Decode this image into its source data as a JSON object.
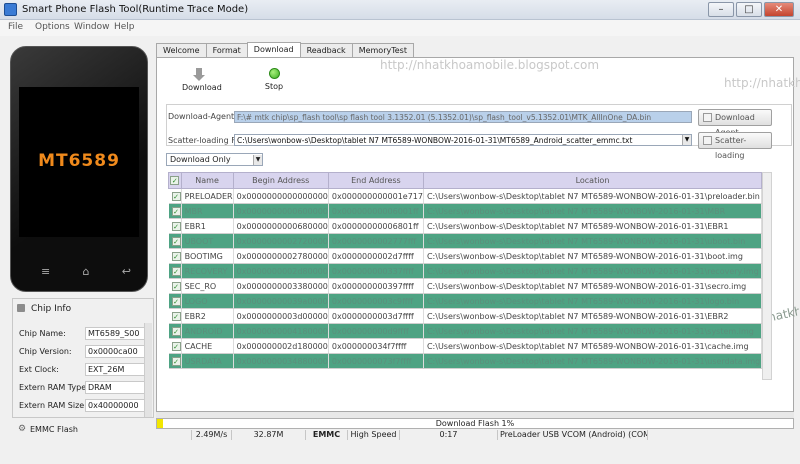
{
  "window": {
    "title": "Smart Phone Flash Tool(Runtime Trace Mode)",
    "minimize": "–",
    "maximize": "□",
    "close": "✕"
  },
  "menu": [
    "File",
    "Options",
    "Window",
    "Help"
  ],
  "watermark": "http://nhatkhoamobile.blogspot.com",
  "phone": {
    "chip_label": "MT6589",
    "keys": [
      "≡",
      "⌂",
      "↩"
    ]
  },
  "chip_info": {
    "title": "Chip Info",
    "rows": [
      {
        "label": "Chip Name:",
        "value": "MT6589_S00"
      },
      {
        "label": "Chip Version:",
        "value": "0x0000ca00"
      },
      {
        "label": "Ext Clock:",
        "value": "EXT_26M"
      },
      {
        "label": "Extern RAM Type:",
        "value": "DRAM"
      },
      {
        "label": "Extern RAM Size:",
        "value": "0x40000000"
      }
    ],
    "emmc_flash": "EMMC Flash"
  },
  "tabs": [
    "Welcome",
    "Format",
    "Download",
    "Readback",
    "MemoryTest"
  ],
  "toolbar": {
    "download": "Download",
    "stop": "Stop"
  },
  "config": {
    "download_agent_label": "Download-Agent",
    "download_agent_path": "F:\\# mtk chip\\sp_flash tool\\sp flash tool 3.1352.01 (5.1352.01)\\sp_flash_tool_v5.1352.01\\MTK_AllInOne_DA.bin",
    "download_agent_button": "Download Agent",
    "scatter_label": "Scatter-loading File",
    "scatter_path": "C:\\Users\\wonbow-s\\Desktop\\tablet N7 MT6589-WONBOW-2016-01-31\\MT6589_Android_scatter_emmc.txt",
    "scatter_button": "Scatter-loading"
  },
  "mode": "Download Only",
  "table": {
    "headers": [
      "",
      "Name",
      "Begin Address",
      "End Address",
      "Location"
    ],
    "rows": [
      {
        "name": "PRELOADER",
        "begin": "0x0000000000000000",
        "end": "0x000000000001e717",
        "location": "C:\\Users\\wonbow-s\\Desktop\\tablet N7 MT6589-WONBOW-2016-01-31\\preloader.bin",
        "hl": false
      },
      {
        "name": "MBR",
        "begin": "0x0000000000600000",
        "end": "0x00000000006001ff",
        "location": "C:\\Users\\wonbow-s\\Desktop\\tablet N7 MT6589-WONBOW-2016-01-31\\MBR",
        "hl": true
      },
      {
        "name": "EBR1",
        "begin": "0x0000000000680000",
        "end": "0x00000000006801ff",
        "location": "C:\\Users\\wonbow-s\\Desktop\\tablet N7 MT6589-WONBOW-2016-01-31\\EBR1",
        "hl": false
      },
      {
        "name": "UBOOT",
        "begin": "0x0000000002720000",
        "end": "0x0000000002777fff",
        "location": "C:\\Users\\wonbow-s\\Desktop\\tablet N7 MT6589-WONBOW-2016-01-31\\uboot.bin",
        "hl": true
      },
      {
        "name": "BOOTIMG",
        "begin": "0x0000000002780000",
        "end": "0x0000000002d7ffff",
        "location": "C:\\Users\\wonbow-s\\Desktop\\tablet N7 MT6589-WONBOW-2016-01-31\\boot.img",
        "hl": false
      },
      {
        "name": "RECOVERY",
        "begin": "0x0000000002d80000",
        "end": "0x000000000337ffff",
        "location": "C:\\Users\\wonbow-s\\Desktop\\tablet N7 MT6589-WONBOW-2016-01-31\\recovery.img",
        "hl": true
      },
      {
        "name": "SEC_RO",
        "begin": "0x0000000003380000",
        "end": "0x000000000397ffff",
        "location": "C:\\Users\\wonbow-s\\Desktop\\tablet N7 MT6589-WONBOW-2016-01-31\\secro.img",
        "hl": false
      },
      {
        "name": "LOGO",
        "begin": "0x00000000039a0000",
        "end": "0x0000000003c9ffff",
        "location": "C:\\Users\\wonbow-s\\Desktop\\tablet N7 MT6589-WONBOW-2016-01-31\\logo.bin",
        "hl": true
      },
      {
        "name": "EBR2",
        "begin": "0x0000000003d00000",
        "end": "0x0000000003d7ffff",
        "location": "C:\\Users\\wonbow-s\\Desktop\\tablet N7 MT6589-WONBOW-2016-01-31\\EBR2",
        "hl": false
      },
      {
        "name": "ANDROID",
        "begin": "0x0000000004180000",
        "end": "0x000000000d9ffff",
        "location": "C:\\Users\\wonbow-s\\Desktop\\tablet N7 MT6589-WONBOW-2016-01-31\\system.img",
        "hl": true
      },
      {
        "name": "CACHE",
        "begin": "0x000000002d180000",
        "end": "0x000000034f7ffff",
        "location": "C:\\Users\\wonbow-s\\Desktop\\tablet N7 MT6589-WONBOW-2016-01-31\\cache.img",
        "hl": false
      },
      {
        "name": "USRDATA",
        "begin": "0x0000000034880000",
        "end": "0x0000000073f7ffff",
        "location": "C:\\Users\\wonbow-s\\Desktop\\tablet N7 MT6589-WONBOW-2016-01-31\\userdata.img",
        "hl": true
      }
    ]
  },
  "progress": {
    "label": "Download Flash 1%",
    "fraction": 0.01
  },
  "status": [
    "",
    "2.49M/s",
    "32.87M",
    "EMMC",
    "High Speed",
    "0:17",
    "PreLoader USB VCOM (Android) (COM4)"
  ],
  "colors": {
    "accent": "#3a7bd5",
    "row_highlight": "#4ea383",
    "progress": "#f2e600",
    "table_header": "#d8d4ee",
    "chip_label": "#f08a1c"
  }
}
